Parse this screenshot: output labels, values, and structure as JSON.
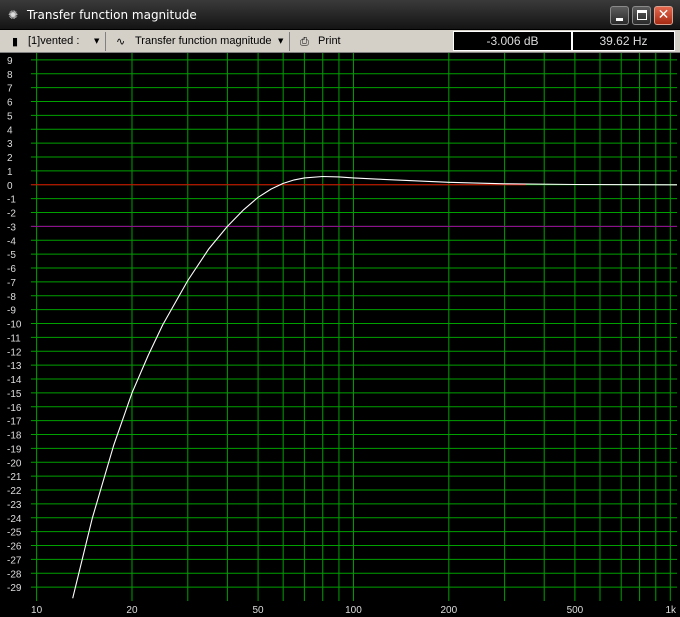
{
  "window": {
    "title": "Transfer function magnitude",
    "controls": {
      "minimize_icon": "minimize-icon",
      "maximize_icon": "maximize-icon",
      "close_icon": "close-icon"
    }
  },
  "toolbar": {
    "selector_label": "[1]vented :",
    "mode_label": "Transfer function magnitude",
    "print_label": "Print",
    "readout_db": "-3.006 dB",
    "readout_hz": "39.62 Hz"
  },
  "colors": {
    "grid": "#00a000",
    "curve": "#ffffff",
    "zero_line": "#e00000",
    "minus3_line": "#a000a0",
    "axis_text": "#dcdcdc"
  },
  "chart_data": {
    "type": "line",
    "x_scale": "log",
    "xlim": [
      9.6,
      1050
    ],
    "ylim": [
      -30,
      9.5
    ],
    "x_tick_labels": [
      {
        "value": 10,
        "label": "10"
      },
      {
        "value": 20,
        "label": "20"
      },
      {
        "value": 50,
        "label": "50"
      },
      {
        "value": 100,
        "label": "100"
      },
      {
        "value": 200,
        "label": "200"
      },
      {
        "value": 500,
        "label": "500"
      },
      {
        "value": 1000,
        "label": "1k"
      }
    ],
    "x_gridlines": [
      10,
      20,
      30,
      40,
      50,
      60,
      70,
      80,
      90,
      100,
      200,
      300,
      400,
      500,
      600,
      700,
      800,
      900,
      1000
    ],
    "y_ticks": [
      9,
      8,
      7,
      6,
      5,
      4,
      3,
      2,
      1,
      0,
      -1,
      -2,
      -3,
      -4,
      -5,
      -6,
      -7,
      -8,
      -9,
      -10,
      -11,
      -12,
      -13,
      -14,
      -15,
      -16,
      -17,
      -18,
      -19,
      -20,
      -21,
      -22,
      -23,
      -24,
      -25,
      -26,
      -27,
      -28,
      -29
    ],
    "reference_lines": [
      {
        "y": 0,
        "color": "#e00000",
        "x_end": 350
      },
      {
        "y": -3,
        "color": "#a000a0"
      }
    ],
    "series": [
      {
        "x": [
          13,
          15,
          17.5,
          20,
          22.5,
          25,
          30,
          35,
          40,
          45,
          50,
          55,
          60,
          65,
          70,
          80,
          90,
          100,
          120,
          150,
          200,
          300,
          500,
          1000,
          1050
        ],
        "y": [
          -29.8,
          -24.0,
          -18.8,
          -15.0,
          -12.3,
          -10.1,
          -6.9,
          -4.6,
          -3.0,
          -1.8,
          -0.9,
          -0.3,
          0.1,
          0.35,
          0.5,
          0.6,
          0.57,
          0.5,
          0.4,
          0.3,
          0.18,
          0.07,
          0.02,
          0.0,
          0.0
        ]
      }
    ]
  }
}
